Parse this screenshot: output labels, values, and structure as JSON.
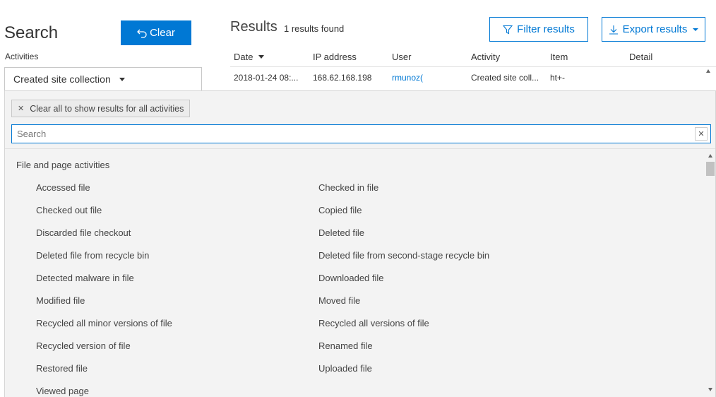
{
  "search_panel": {
    "title": "Search",
    "clear_label": "Clear",
    "activities_label": "Activities",
    "activity_selected": "Created site collection"
  },
  "results": {
    "title": "Results",
    "count": "1 results found",
    "filter_label": "Filter results",
    "export_label": "Export results",
    "columns": [
      "Date",
      "IP address",
      "User",
      "Activity",
      "Item",
      "Detail"
    ],
    "rows": [
      {
        "date": "2018-01-24 08:...",
        "ip": "168.62.168.198",
        "user": "rmunoz(",
        "activity": "Created site coll...",
        "item": "ht+-",
        "detail": ""
      }
    ]
  },
  "dropdown": {
    "clear_all_label": "Clear all to show results for all activities",
    "search_placeholder": "Search",
    "group_label": "File and page activities",
    "left_items": [
      "Accessed file",
      "Checked out file",
      "Discarded file checkout",
      "Deleted file from recycle bin",
      "Detected malware in file",
      "Modified file",
      "Recycled all minor versions of file",
      "Recycled version of file",
      "Restored file",
      "Viewed page"
    ],
    "right_items": [
      "Checked in file",
      "Copied file",
      "Deleted file",
      "Deleted file from second-stage recycle bin",
      "Downloaded file",
      "Moved file",
      "Recycled all versions of file",
      "Renamed file",
      "Uploaded file"
    ]
  },
  "colors": {
    "accent": "#0078d4",
    "panel_bg": "#f3f3f3"
  }
}
